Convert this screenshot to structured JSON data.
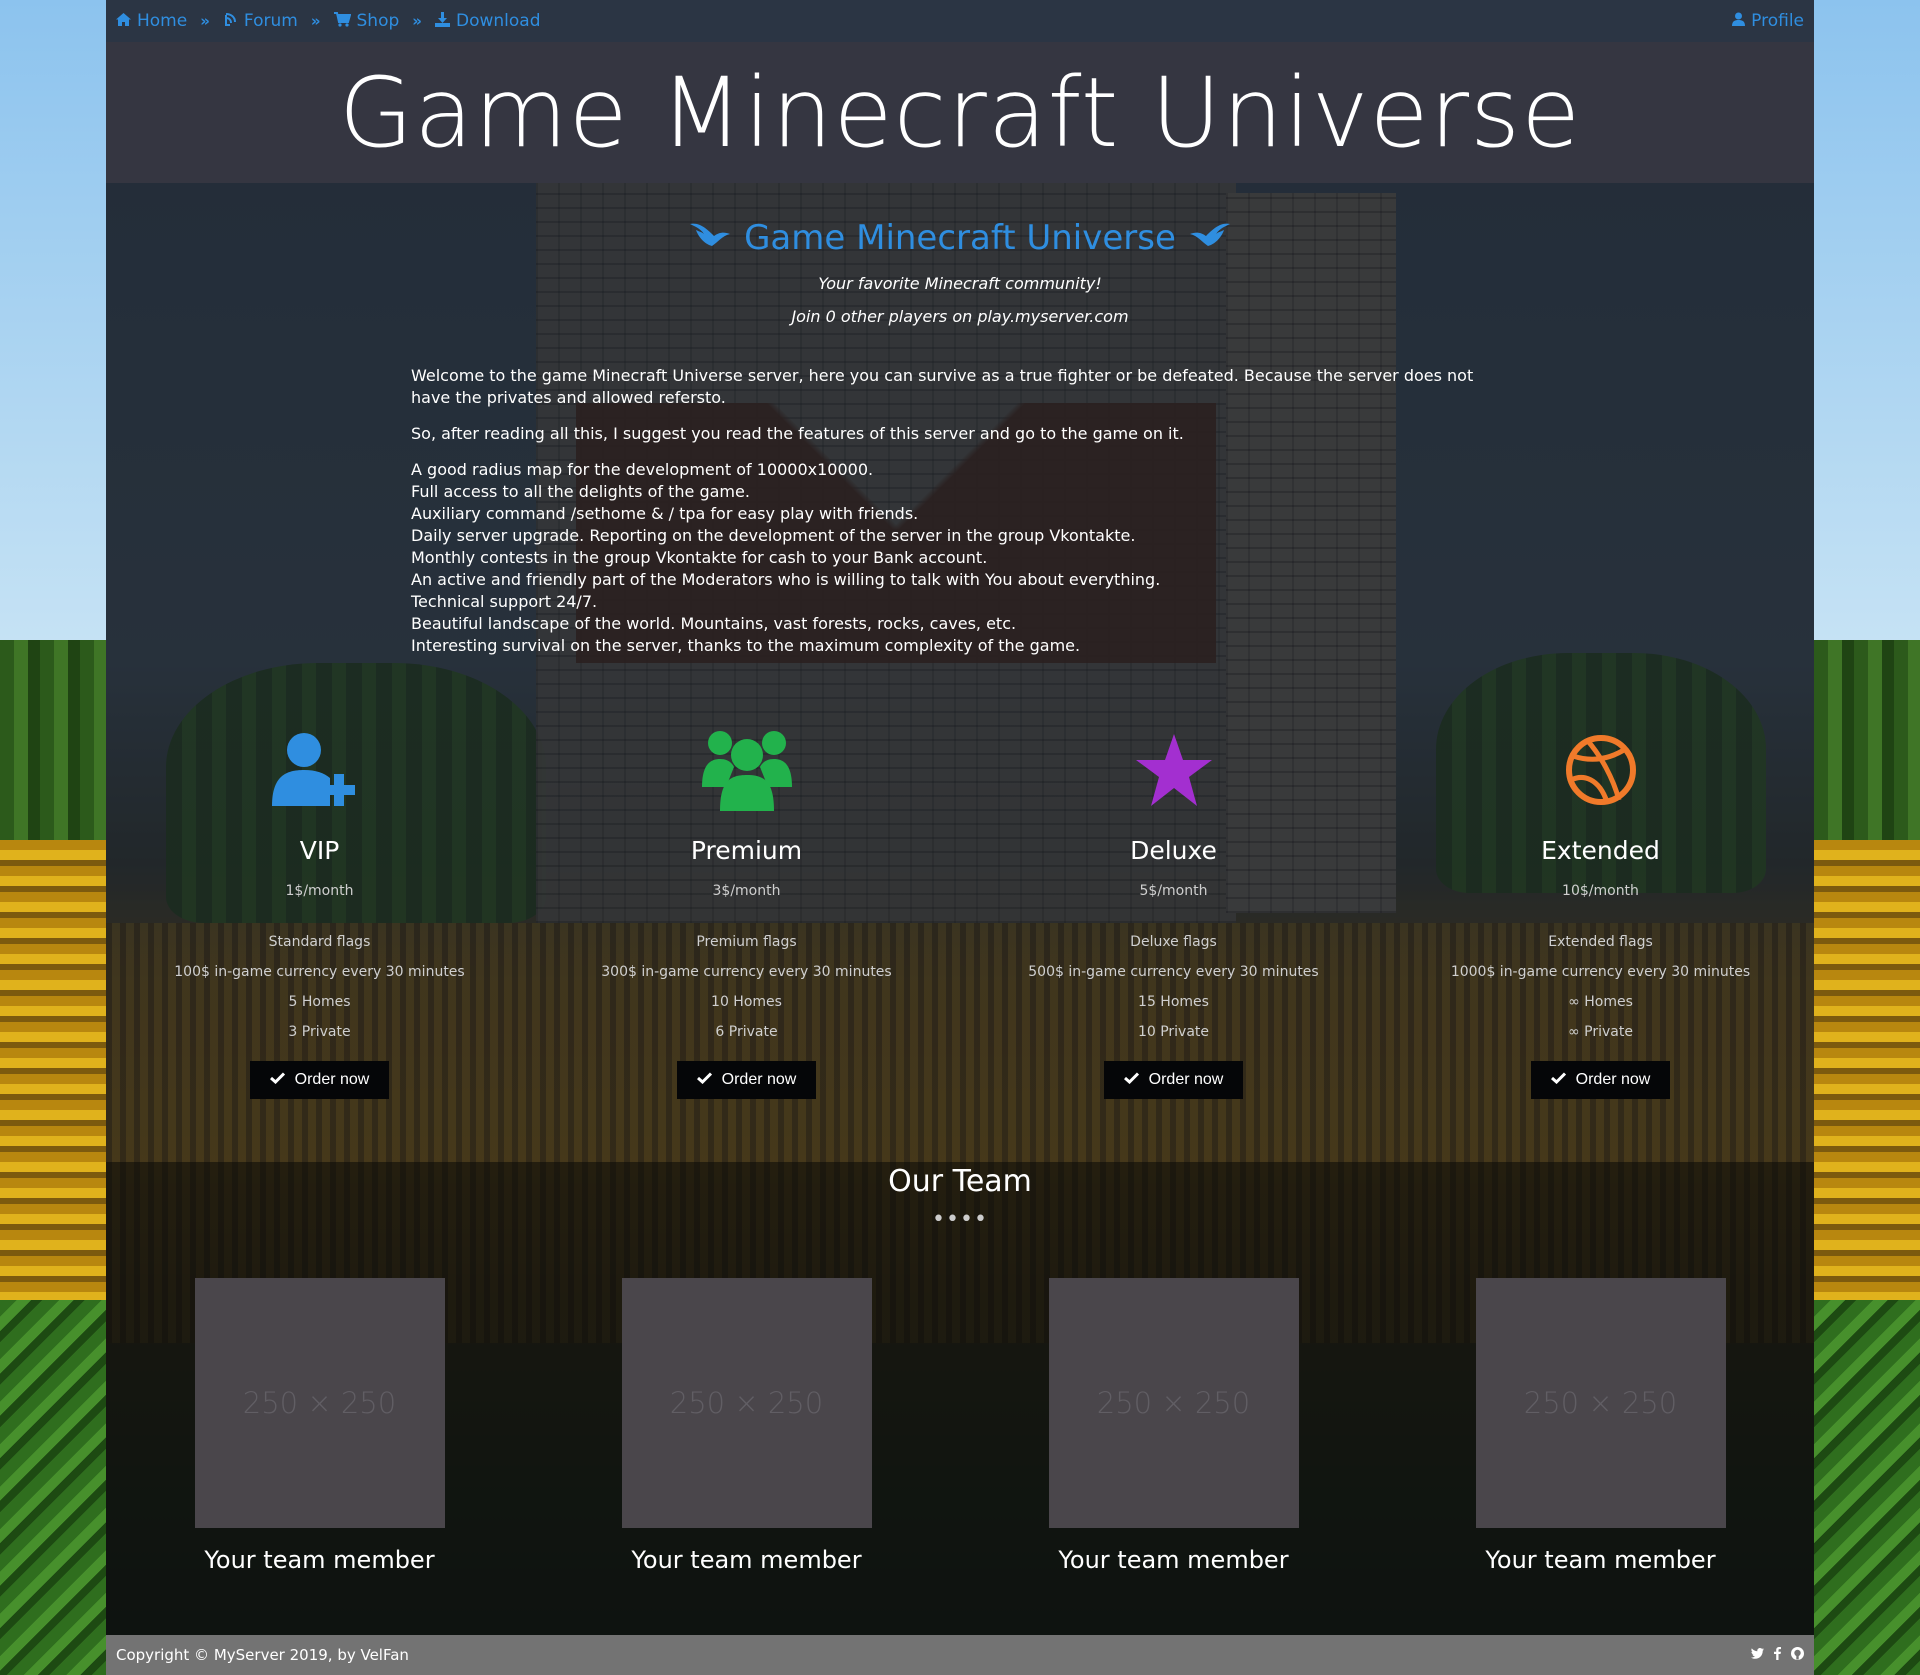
{
  "nav": {
    "items": [
      {
        "label": "Home",
        "icon": "home-icon"
      },
      {
        "label": "Forum",
        "icon": "forum-icon"
      },
      {
        "label": "Shop",
        "icon": "cart-icon"
      },
      {
        "label": "Download",
        "icon": "download-icon"
      }
    ],
    "profile": "Profile",
    "link_color": "#2f8ee0"
  },
  "header": {
    "title": "Game Minecraft Universe"
  },
  "intro": {
    "title": "Game Minecraft Universe",
    "tagline": "Your favorite Minecraft community!",
    "players": "Join 0 other players on play.myserver.com"
  },
  "text": {
    "p1": "Welcome to the game Minecraft Universe server, here you can survive as a true fighter or be defeated. Because the server does not have the privates and allowed refersto.",
    "p2": "So, after reading all this, I suggest you read the features of this server and go to the game on it.",
    "features": [
      "A good radius map for the development of 10000x10000.",
      "Full access to all the delights of the game.",
      "Auxiliary command /sethome & / tpa for easy play with friends.",
      "Daily server upgrade. Reporting on the development of the server in the group Vkontakte.",
      "Monthly contests in the group Vkontakte for cash to your Bank account.",
      "An active and friendly part of the Moderators who is willing to talk with You about everything.",
      "Technical support 24/7.",
      "Beautiful landscape of the world. Mountains, vast forests, rocks, caves, etc.",
      "Interesting survival on the server, thanks to the maximum complexity of the game."
    ]
  },
  "plans": [
    {
      "name": "VIP",
      "price": "1$/month",
      "icon": "user-plus-icon",
      "color": "#2f8ee0",
      "features": [
        "Standard flags",
        "100$ in-game currency every 30 minutes",
        "5 Homes",
        "3 Private"
      ],
      "button": "Order now"
    },
    {
      "name": "Premium",
      "price": "3$/month",
      "icon": "users-icon",
      "color": "#22b24c",
      "features": [
        "Premium flags",
        "300$ in-game currency every 30 minutes",
        "10 Homes",
        "6 Private"
      ],
      "button": "Order now"
    },
    {
      "name": "Deluxe",
      "price": "5$/month",
      "icon": "star-icon",
      "color": "#a32fd0",
      "features": [
        "Deluxe flags",
        "500$ in-game currency every 30 minutes",
        "15 Homes",
        "10 Private"
      ],
      "button": "Order now"
    },
    {
      "name": "Extended",
      "price": "10$/month",
      "icon": "basketball-icon",
      "color": "#f07a2a",
      "features": [
        "Extended flags",
        "1000$ in-game currency every 30 minutes",
        "∞ Homes",
        "∞ Private"
      ],
      "button": "Order now"
    }
  ],
  "team": {
    "title": "Our Team",
    "dots": "••••",
    "members": [
      {
        "placeholder": "250 × 250",
        "name": "Your team member"
      },
      {
        "placeholder": "250 × 250",
        "name": "Your team member"
      },
      {
        "placeholder": "250 × 250",
        "name": "Your team member"
      },
      {
        "placeholder": "250 × 250",
        "name": "Your team member"
      }
    ]
  },
  "footer": {
    "copyright": "Copyright © MyServer 2019, by ",
    "author": "VelFan",
    "social": [
      "twitter-icon",
      "facebook-icon",
      "github-icon"
    ]
  }
}
